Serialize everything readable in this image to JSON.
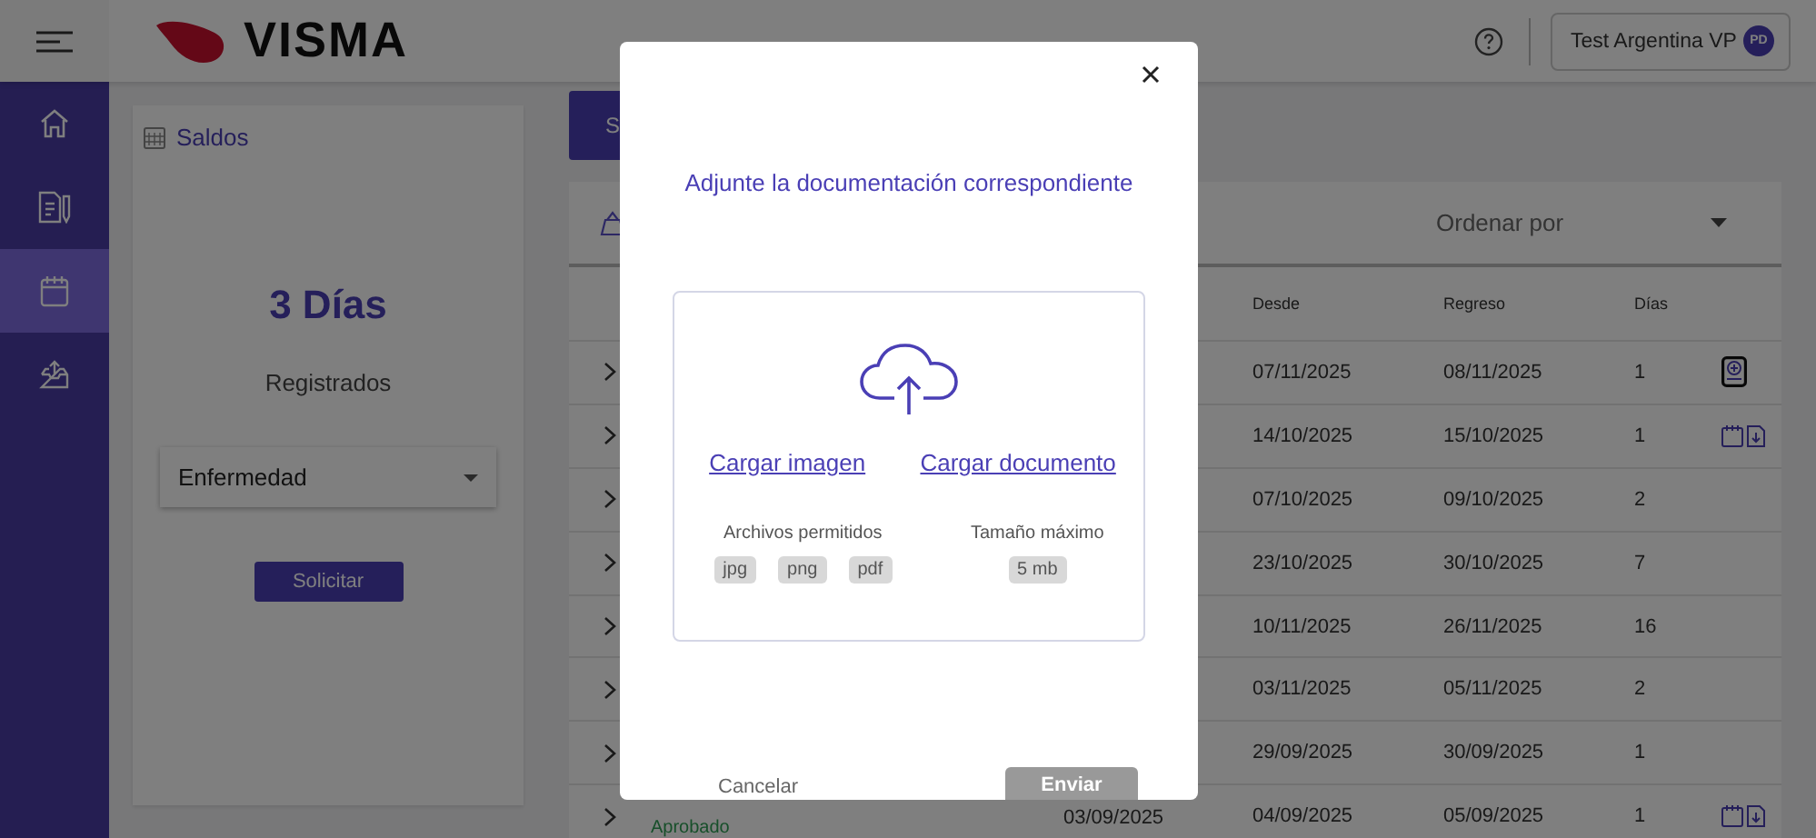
{
  "header": {
    "logo": "VISMA",
    "user_name": "Test Argentina VP",
    "avatar_initials": "PD"
  },
  "sidebar": {
    "items": [
      {
        "kind": "home",
        "selected": false
      },
      {
        "kind": "document",
        "selected": false
      },
      {
        "kind": "calendar",
        "selected": true
      },
      {
        "kind": "inbox",
        "selected": false
      }
    ]
  },
  "balance_card": {
    "title": "Saldos",
    "amount": "3 Días",
    "caption": "Registrados",
    "leave_type": "Enfermedad",
    "button": "Solicitar"
  },
  "tab_button": "S",
  "table": {
    "sort_placeholder": "Ordenar por",
    "columns": [
      "Desde",
      "Regreso",
      "Días"
    ],
    "rows": [
      {
        "desde": "07/11/2025",
        "regreso": "08/11/2025",
        "dias": "1",
        "kind": "add"
      },
      {
        "desde": "14/10/2025",
        "regreso": "15/10/2025",
        "dias": "1",
        "kind": "calendar-download"
      },
      {
        "desde": "07/10/2025",
        "regreso": "09/10/2025",
        "dias": "2",
        "kind": "plain"
      },
      {
        "desde": "23/10/2025",
        "regreso": "30/10/2025",
        "dias": "7",
        "kind": "plain"
      },
      {
        "desde": "10/11/2025",
        "regreso": "26/11/2025",
        "dias": "16",
        "kind": "plain"
      },
      {
        "desde": "03/11/2025",
        "regreso": "05/11/2025",
        "dias": "2",
        "kind": "plain"
      },
      {
        "desde": "29/09/2025",
        "regreso": "30/09/2025",
        "dias": "1",
        "kind": "plain"
      },
      {
        "status": "Aprobado",
        "requested": "03/09/2025",
        "desde": "04/09/2025",
        "regreso": "05/09/2025",
        "dias": "1",
        "kind": "calendar-download"
      }
    ]
  },
  "modal": {
    "title": "Adjunte la documentación correspondiente",
    "upload_image": "Cargar imagen",
    "upload_document": "Cargar documento",
    "allowed_label": "Archivos permitidos",
    "allowed_types": [
      "jpg",
      "png",
      "pdf"
    ],
    "max_size_label": "Tamaño máximo",
    "max_size": "5 mb",
    "cancel": "Cancelar",
    "submit": "Enviar"
  }
}
